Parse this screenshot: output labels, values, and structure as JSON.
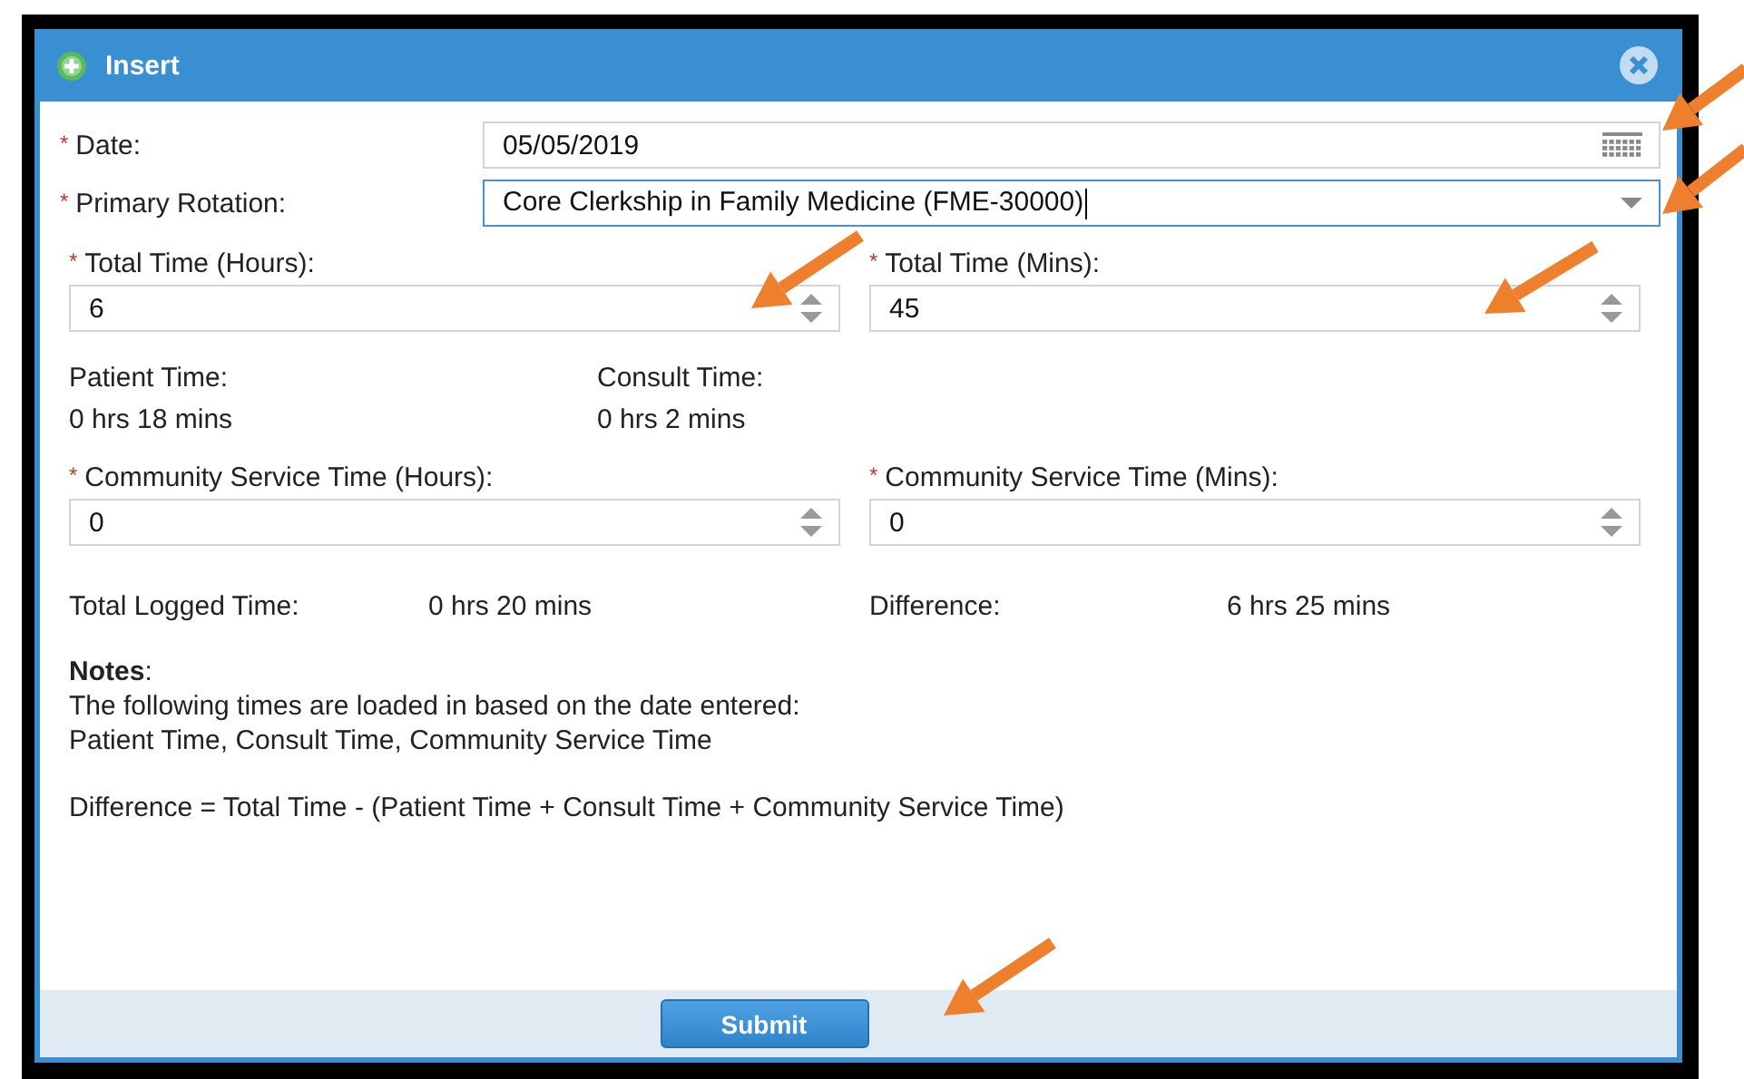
{
  "dialog": {
    "title": "Insert"
  },
  "rows": [
    {
      "mark": "*",
      "label": "Date:",
      "value": "05/05/2019",
      "kind": "date",
      "focused": false
    },
    {
      "mark": "*",
      "label": "Primary Rotation:",
      "value": "Core Clerkship in Family Medicine (FME-30000)",
      "kind": "select",
      "focused": true
    }
  ],
  "total_time": [
    {
      "mark": "*",
      "label": "Total Time (Hours):",
      "value": "6",
      "kind": "number",
      "focused": false
    },
    {
      "mark": "*",
      "label": "Total Time (Mins):",
      "value": "45",
      "kind": "number",
      "focused": false
    }
  ],
  "computed": [
    {
      "label": "Patient Time:",
      "value": "0 hrs 18 mins"
    },
    {
      "label": "Consult Time:",
      "value": "0 hrs 2 mins"
    }
  ],
  "community": [
    {
      "mark": "*",
      "label": "Community Service Time (Hours):",
      "value": "0",
      "kind": "number",
      "focused": false
    },
    {
      "mark": "*",
      "label": "Community Service Time (Mins):",
      "value": "0",
      "kind": "number",
      "focused": false
    }
  ],
  "summary": [
    {
      "label": "Total Logged Time:",
      "value": "0 hrs 20 mins"
    },
    {
      "label": "Difference:",
      "value": "6 hrs 25 mins"
    }
  ],
  "notes": {
    "heading": "**Notes**:",
    "lines": [
      "The following times are loaded in based on the date entered:",
      "Patient Time, Consult Time, Community Service Time"
    ],
    "formula": "Difference = Total Time - (Patient Time + Consult Time + Community Service Time)"
  },
  "submit": "Submit"
}
